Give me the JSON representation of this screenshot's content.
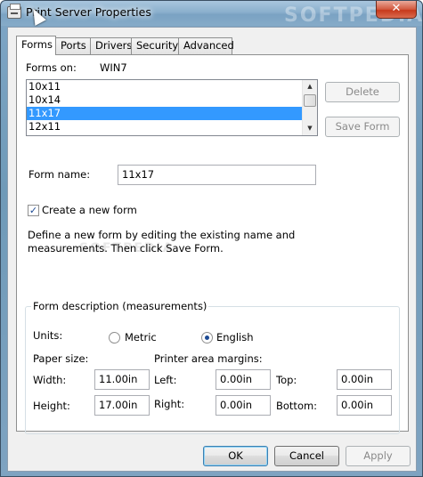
{
  "window": {
    "title": "Print Server Properties",
    "close_glyph": "✕",
    "watermark": "SOFTPEDIA"
  },
  "tabs": [
    {
      "label": "Forms",
      "active": true
    },
    {
      "label": "Ports"
    },
    {
      "label": "Drivers"
    },
    {
      "label": "Security"
    },
    {
      "label": "Advanced"
    }
  ],
  "forms": {
    "forms_on_label": "Forms on:",
    "server": "WIN7",
    "list": [
      "10x11",
      "10x14",
      "11x17",
      "12x11"
    ],
    "selected": "11x17",
    "delete_button": "Delete",
    "save_form_button": "Save Form",
    "form_name_label": "Form name:",
    "form_name_value": "11x17",
    "create_new_label": "Create a new form",
    "create_new_checked": true,
    "description_line1": "Define a new form by editing the existing name and",
    "description_line2": "measurements. Then click Save Form.",
    "group_title": "Form description (measurements)",
    "units_label": "Units:",
    "metric_label": "Metric",
    "english_label": "English",
    "units_selected": "English",
    "paper_size_label": "Paper size:",
    "margins_label": "Printer area margins:",
    "width_label": "Width:",
    "width_value": "11.00in",
    "height_label": "Height:",
    "height_value": "17.00in",
    "left_label": "Left:",
    "left_value": "0.00in",
    "right_label": "Right:",
    "right_value": "0.00in",
    "top_label": "Top:",
    "top_value": "0.00in",
    "bottom_label": "Bottom:",
    "bottom_value": "0.00in"
  },
  "footer": {
    "ok": "OK",
    "cancel": "Cancel",
    "apply": "Apply"
  },
  "colors": {
    "selection": "#3399ff",
    "title_gradient": "#8bb0cd",
    "close": "#c7391b"
  }
}
